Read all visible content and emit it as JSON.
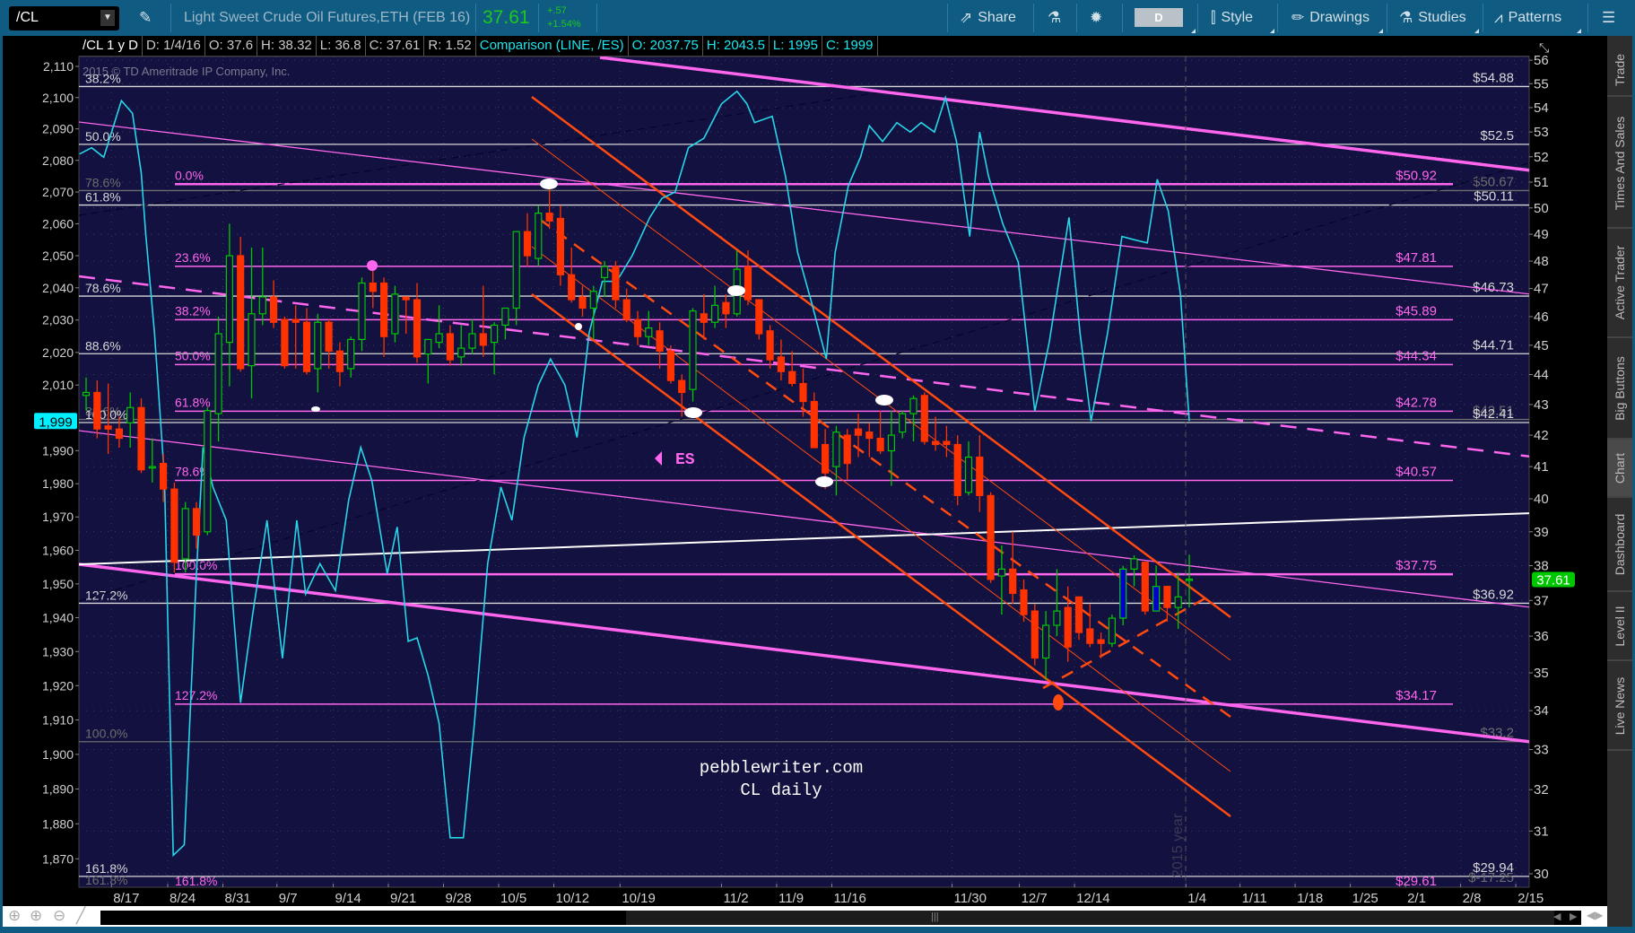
{
  "toolbar": {
    "symbol": "/CL",
    "description": "Light Sweet Crude Oil Futures,ETH (FEB 16)",
    "last": "37.61",
    "change": "+.57",
    "change_pct": "+1.54%",
    "share": "Share",
    "period": "D",
    "style": "Style",
    "drawings": "Drawings",
    "studies": "Studies",
    "patterns": "Patterns"
  },
  "infobar": [
    {
      "text": "/CL 1 y D",
      "color": "#ffffff"
    },
    {
      "text": "D: 1/4/16",
      "color": "#c8c8c8"
    },
    {
      "text": "O: 37.6",
      "color": "#c8c8c8"
    },
    {
      "text": "H: 38.32",
      "color": "#c8c8c8"
    },
    {
      "text": "L: 36.8",
      "color": "#c8c8c8"
    },
    {
      "text": "C: 37.61",
      "color": "#c8c8c8"
    },
    {
      "text": "R: 1.52",
      "color": "#c8c8c8"
    },
    {
      "text": "Comparison (LINE, /ES)",
      "color": "#1ee6f0"
    },
    {
      "text": "O: 2037.75",
      "color": "#1ee6f0"
    },
    {
      "text": "H: 2043.5",
      "color": "#1ee6f0"
    },
    {
      "text": "L: 1995",
      "color": "#1ee6f0"
    },
    {
      "text": "C: 1999",
      "color": "#1ee6f0"
    }
  ],
  "copyright": "2015 © TD Ameritrade IP Company, Inc.",
  "watermark": [
    "pebblewriter.com",
    "CL daily"
  ],
  "annotations": {
    "es_label": "ES",
    "year_label": "2015 year"
  },
  "sidebar_tabs": [
    {
      "label": "Trade",
      "active": false
    },
    {
      "label": "Times And Sales",
      "active": false
    },
    {
      "label": "Active Trader",
      "active": false
    },
    {
      "label": "Big Buttons",
      "active": false
    },
    {
      "label": "Chart",
      "active": true
    },
    {
      "label": "Dashboard",
      "active": false
    },
    {
      "label": "Level II",
      "active": false
    },
    {
      "label": "Live News",
      "active": false
    }
  ],
  "colors": {
    "up": "#00c800",
    "down": "#ff3300",
    "highlight": "#0000cc",
    "es_line": "#27d6e8",
    "fib": "#ff66ee",
    "channel": "#ff4a10",
    "chart_bg": "#13113f"
  },
  "chart_data": {
    "type": "candlestick",
    "title": "/CL 1 y D",
    "right_axis": {
      "label": "CL price",
      "ticks": [
        30,
        31,
        32,
        33,
        34,
        35,
        36,
        37,
        38,
        39,
        40,
        41,
        42,
        43,
        44,
        45,
        46,
        47,
        48,
        49,
        50,
        51,
        52,
        53,
        54,
        55,
        56
      ],
      "scale": "log"
    },
    "left_axis": {
      "label": "/ES comparison",
      "ticks": [
        "2,110",
        "2,100",
        "2,090",
        "2,080",
        "2,070",
        "2,060",
        "2,050",
        "2,040",
        "2,030",
        "2,020",
        "2,010",
        "1,990",
        "1,980",
        "1,970",
        "1,960",
        "1,950",
        "1,940",
        "1,930",
        "1,920",
        "1,910",
        "1,900",
        "1,890",
        "1,880",
        "1,870"
      ],
      "scale": "log"
    },
    "date_ticks": [
      {
        "label": "8/17",
        "day": 2.3
      },
      {
        "label": "8/24",
        "day": 7.4
      },
      {
        "label": "8/31",
        "day": 12.4
      },
      {
        "label": "9/7",
        "day": 17.3
      },
      {
        "label": "9/14",
        "day": 22.4
      },
      {
        "label": "9/21",
        "day": 27.4
      },
      {
        "label": "9/28",
        "day": 32.4
      },
      {
        "label": "10/5",
        "day": 37.4
      },
      {
        "label": "10/12",
        "day": 42.4
      },
      {
        "label": "10/19",
        "day": 48.4
      },
      {
        "label": "11/2",
        "day": 57.6
      },
      {
        "label": "11/9",
        "day": 62.6
      },
      {
        "label": "11/16",
        "day": 67.6
      },
      {
        "label": "11/30",
        "day": 78.5
      },
      {
        "label": "12/7",
        "day": 84.6
      },
      {
        "label": "12/14",
        "day": 89.6
      },
      {
        "label": "1/4",
        "day": 99.7
      },
      {
        "label": "1/11",
        "day": 104.6
      },
      {
        "label": "1/18",
        "day": 109.6
      },
      {
        "label": "1/25",
        "day": 114.6
      },
      {
        "label": "2/1",
        "day": 119.6
      },
      {
        "label": "2/8",
        "day": 124.6
      },
      {
        "label": "2/15",
        "day": 129.6
      }
    ],
    "candles_ohlc": [
      [
        43.3,
        43.9,
        42.8,
        43.4
      ],
      [
        43.4,
        43.8,
        41.9,
        42.2
      ],
      [
        42.3,
        43.7,
        41.4,
        42.2
      ],
      [
        42.2,
        42.6,
        41.6,
        41.9
      ],
      [
        42.4,
        43.4,
        41.6,
        42.9
      ],
      [
        42.9,
        43.2,
        40.8,
        40.9
      ],
      [
        41.0,
        41.9,
        40.5,
        41.0
      ],
      [
        41.1,
        41.4,
        39.9,
        40.3
      ],
      [
        40.3,
        40.5,
        37.8,
        38.1
      ],
      [
        38.2,
        39.9,
        37.8,
        39.7
      ],
      [
        39.7,
        39.9,
        38.5,
        38.9
      ],
      [
        39.0,
        42.9,
        38.9,
        42.8
      ],
      [
        42.7,
        46.0,
        41.8,
        45.4
      ],
      [
        45.1,
        49.4,
        43.6,
        48.2
      ],
      [
        48.2,
        48.9,
        44.1,
        44.2
      ],
      [
        44.3,
        48.5,
        43.2,
        46.1
      ],
      [
        46.1,
        48.5,
        45.7,
        46.7
      ],
      [
        46.7,
        47.3,
        45.6,
        45.8
      ],
      [
        45.9,
        46.0,
        44.2,
        44.3
      ],
      [
        45.9,
        46.4,
        44.2,
        45.8
      ],
      [
        45.8,
        46.3,
        44.0,
        44.1
      ],
      [
        44.2,
        46.1,
        43.4,
        45.8
      ],
      [
        45.8,
        45.9,
        44.2,
        44.8
      ],
      [
        44.8,
        45.1,
        43.6,
        44.1
      ],
      [
        44.2,
        45.3,
        43.9,
        45.2
      ],
      [
        45.2,
        47.4,
        44.8,
        47.2
      ],
      [
        47.2,
        47.8,
        46.3,
        46.9
      ],
      [
        47.2,
        47.4,
        44.6,
        45.3
      ],
      [
        45.4,
        47.1,
        45.1,
        46.8
      ],
      [
        46.7,
        46.7,
        45.4,
        46.6
      ],
      [
        46.6,
        47.2,
        44.4,
        44.6
      ],
      [
        44.7,
        45.2,
        43.7,
        45.2
      ],
      [
        45.1,
        46.4,
        44.9,
        45.4
      ],
      [
        45.4,
        45.7,
        44.3,
        44.5
      ],
      [
        44.6,
        45.7,
        44.3,
        44.9
      ],
      [
        44.9,
        45.9,
        44.7,
        45.4
      ],
      [
        45.4,
        47.1,
        44.6,
        45.0
      ],
      [
        45.1,
        45.8,
        44.0,
        45.7
      ],
      [
        45.7,
        46.3,
        45.2,
        46.3
      ],
      [
        46.3,
        49.1,
        45.7,
        49.1
      ],
      [
        49.1,
        49.8,
        47.8,
        48.2
      ],
      [
        48.1,
        50.1,
        47.8,
        49.8
      ],
      [
        49.8,
        50.9,
        49.2,
        49.5
      ],
      [
        49.6,
        50.1,
        47.1,
        47.5
      ],
      [
        47.5,
        48.5,
        46.5,
        46.6
      ],
      [
        46.7,
        47.1,
        46.0,
        46.3
      ],
      [
        46.3,
        47.1,
        45.2,
        46.9
      ],
      [
        47.4,
        48.0,
        46.7,
        47.8
      ],
      [
        47.8,
        48.0,
        46.3,
        46.6
      ],
      [
        46.6,
        47.0,
        45.8,
        45.9
      ],
      [
        45.9,
        46.2,
        45.0,
        45.3
      ],
      [
        45.3,
        46.2,
        45.0,
        45.6
      ],
      [
        45.5,
        45.8,
        44.2,
        44.8
      ],
      [
        44.8,
        45.0,
        43.7,
        43.8
      ],
      [
        43.8,
        44.0,
        42.6,
        43.4
      ],
      [
        43.5,
        46.3,
        43.1,
        46.2
      ],
      [
        46.1,
        46.8,
        45.2,
        45.8
      ],
      [
        45.8,
        47.1,
        45.6,
        46.4
      ],
      [
        46.5,
        46.8,
        45.6,
        46.1
      ],
      [
        46.1,
        48.4,
        46.0,
        47.7
      ],
      [
        47.8,
        48.4,
        46.4,
        46.6
      ],
      [
        46.6,
        46.6,
        45.2,
        45.4
      ],
      [
        45.5,
        45.7,
        44.2,
        44.5
      ],
      [
        44.6,
        45.2,
        43.8,
        44.1
      ],
      [
        44.1,
        44.8,
        43.6,
        43.7
      ],
      [
        43.7,
        44.2,
        42.6,
        43.1
      ],
      [
        43.1,
        43.4,
        41.6,
        41.6
      ],
      [
        41.7,
        42.2,
        40.3,
        40.8
      ],
      [
        41.0,
        42.3,
        40.1,
        42.1
      ],
      [
        42.0,
        42.2,
        40.6,
        41.1
      ],
      [
        42.2,
        42.7,
        41.3,
        42.0
      ],
      [
        42.1,
        42.4,
        41.3,
        41.9
      ],
      [
        41.9,
        42.8,
        41.4,
        41.5
      ],
      [
        41.5,
        42.8,
        40.4,
        42.0
      ],
      [
        42.1,
        42.8,
        41.9,
        42.7
      ],
      [
        42.7,
        43.3,
        41.8,
        43.2
      ],
      [
        43.3,
        43.4,
        41.7,
        41.8
      ],
      [
        41.8,
        42.6,
        41.5,
        41.7
      ],
      [
        41.8,
        42.3,
        41.3,
        41.7
      ],
      [
        41.7,
        42.0,
        39.8,
        40.1
      ],
      [
        40.2,
        41.8,
        40.1,
        41.3
      ],
      [
        41.3,
        42.0,
        39.6,
        40.1
      ],
      [
        40.1,
        40.2,
        37.5,
        37.6
      ],
      [
        37.7,
        38.6,
        36.6,
        37.9
      ],
      [
        37.9,
        39.0,
        36.9,
        37.2
      ],
      [
        37.3,
        37.6,
        36.4,
        36.6
      ],
      [
        36.7,
        36.9,
        35.2,
        35.4
      ],
      [
        35.4,
        36.7,
        34.8,
        36.3
      ],
      [
        36.3,
        37.9,
        36.0,
        36.7
      ],
      [
        36.8,
        37.4,
        35.3,
        35.7
      ],
      [
        37.1,
        37.1,
        35.9,
        36.1
      ],
      [
        36.2,
        36.9,
        35.7,
        35.8
      ],
      [
        35.9,
        36.1,
        35.4,
        35.8
      ],
      [
        35.8,
        36.6,
        35.7,
        36.5
      ],
      [
        36.5,
        38.0,
        36.3,
        37.9
      ],
      [
        37.9,
        38.3,
        37.4,
        38.2
      ],
      [
        38.1,
        38.1,
        36.6,
        36.7
      ],
      [
        36.7,
        38.0,
        36.7,
        37.4
      ],
      [
        37.4,
        37.4,
        36.4,
        36.8
      ],
      [
        36.8,
        37.8,
        36.2,
        37.1
      ],
      [
        37.6,
        38.32,
        36.8,
        37.61
      ]
    ],
    "highlighted_candles": [
      94,
      97
    ],
    "es_points": [
      [
        -0.6,
        2082
      ],
      [
        0.5,
        2084
      ],
      [
        1.6,
        2081
      ],
      [
        3.2,
        2099
      ],
      [
        4.2,
        2095
      ],
      [
        5.0,
        2076
      ],
      [
        5.4,
        2057
      ],
      [
        6.2,
        2026
      ],
      [
        7.1,
        1982
      ],
      [
        7.9,
        1871
      ],
      [
        8.9,
        1874
      ],
      [
        10.0,
        1953
      ],
      [
        10.6,
        1991
      ],
      [
        11.5,
        1979
      ],
      [
        12.7,
        1969
      ],
      [
        14.0,
        1915
      ],
      [
        15.1,
        1941
      ],
      [
        16.4,
        1969
      ],
      [
        17.8,
        1928
      ],
      [
        19.1,
        1969
      ],
      [
        19.9,
        1947
      ],
      [
        21.2,
        1956
      ],
      [
        22.6,
        1948
      ],
      [
        23.8,
        1975
      ],
      [
        24.9,
        1991
      ],
      [
        25.9,
        1981
      ],
      [
        27.3,
        1953
      ],
      [
        28.2,
        1967
      ],
      [
        29.2,
        1933
      ],
      [
        30.0,
        1934
      ],
      [
        31.0,
        1923
      ],
      [
        32.0,
        1909
      ],
      [
        33.0,
        1876
      ],
      [
        34.2,
        1876
      ],
      [
        35.2,
        1909
      ],
      [
        36.4,
        1956
      ],
      [
        37.6,
        1979
      ],
      [
        38.6,
        1969
      ],
      [
        39.7,
        1994
      ],
      [
        41.0,
        2010
      ],
      [
        42.1,
        2018
      ],
      [
        43.4,
        2010
      ],
      [
        44.5,
        1994
      ],
      [
        45.6,
        2026
      ],
      [
        46.8,
        2042
      ],
      [
        48.1,
        2042
      ],
      [
        49.5,
        2050
      ],
      [
        51.1,
        2062
      ],
      [
        52.2,
        2068
      ],
      [
        53.4,
        2070
      ],
      [
        54.6,
        2084
      ],
      [
        56.0,
        2087
      ],
      [
        57.6,
        2098
      ],
      [
        59.0,
        2102
      ],
      [
        59.9,
        2098
      ],
      [
        60.6,
        2092
      ],
      [
        62.2,
        2094
      ],
      [
        63.4,
        2075
      ],
      [
        64.5,
        2051
      ],
      [
        65.8,
        2035
      ],
      [
        67.1,
        2018
      ],
      [
        67.9,
        2051
      ],
      [
        69.1,
        2072
      ],
      [
        70.2,
        2081
      ],
      [
        71.0,
        2091
      ],
      [
        72.2,
        2086
      ],
      [
        73.5,
        2092
      ],
      [
        74.7,
        2089
      ],
      [
        75.7,
        2092
      ],
      [
        76.9,
        2089
      ],
      [
        77.9,
        2100
      ],
      [
        78.9,
        2086
      ],
      [
        80.1,
        2056
      ],
      [
        81.0,
        2089
      ],
      [
        81.8,
        2075
      ],
      [
        83.1,
        2060
      ],
      [
        84.5,
        2048
      ],
      [
        86.0,
        2002
      ],
      [
        87.3,
        2023
      ],
      [
        89.1,
        2062
      ],
      [
        90.1,
        2026
      ],
      [
        91.1,
        1999
      ],
      [
        92.6,
        2026
      ],
      [
        93.9,
        2056
      ],
      [
        95.0,
        2055
      ],
      [
        96.2,
        2054
      ],
      [
        97.1,
        2074
      ],
      [
        98.1,
        2064
      ],
      [
        99.2,
        2038
      ],
      [
        100,
        1999
      ]
    ],
    "price_levels": [
      {
        "price": 54.88,
        "left": "38.2%",
        "right": "$54.88",
        "kind": "white"
      },
      {
        "price": 52.5,
        "left": "50.0%",
        "right": "$52.5",
        "kind": "white"
      },
      {
        "price": 50.67,
        "left": "78.6%",
        "right": "$50.67",
        "kind": "grey"
      },
      {
        "price": 50.11,
        "left": "61.8%",
        "right": "$50.11",
        "kind": "white"
      },
      {
        "price": 46.73,
        "left": "78.6%",
        "right": "$46.73",
        "kind": "white"
      },
      {
        "price": 44.71,
        "left": "88.6%",
        "right": "$44.71",
        "kind": "white"
      },
      {
        "price": 42.51,
        "left": "88.6%",
        "right": "$42.51",
        "kind": "grey"
      },
      {
        "price": 42.41,
        "left": "100.0%",
        "right": "$42.41",
        "kind": "white"
      },
      {
        "price": 36.92,
        "left": "127.2%",
        "right": "$36.92",
        "kind": "white"
      },
      {
        "price": 33.2,
        "left": "100.0%",
        "right": "$33.2",
        "kind": "grey"
      },
      {
        "price": 29.94,
        "left": "161.8%",
        "right": "$29.94",
        "kind": "white"
      },
      {
        "price": 29.8,
        "left": "161.8%",
        "right": "$-17.25",
        "kind": "grey-bottom"
      }
    ],
    "fib_levels": [
      {
        "price": 50.92,
        "left": "0.0%",
        "right": "$50.92",
        "bold": true
      },
      {
        "price": 47.81,
        "left": "23.6%",
        "right": "$47.81"
      },
      {
        "price": 45.89,
        "left": "38.2%",
        "right": "$45.89"
      },
      {
        "price": 44.34,
        "left": "50.0%",
        "right": "$44.34"
      },
      {
        "price": 42.78,
        "left": "61.8%",
        "right": "$42.78"
      },
      {
        "price": 40.57,
        "left": "78.6%",
        "right": "$40.57"
      },
      {
        "price": 37.75,
        "left": "100.0%",
        "right": "$37.75",
        "bold": true
      },
      {
        "price": 34.17,
        "left": "127.2%",
        "right": "$34.17"
      },
      {
        "price": 29.61,
        "left": "161.8%",
        "right": "$29.61"
      }
    ],
    "last_price_badge": "37.61",
    "es_last_badge": "1,999"
  }
}
